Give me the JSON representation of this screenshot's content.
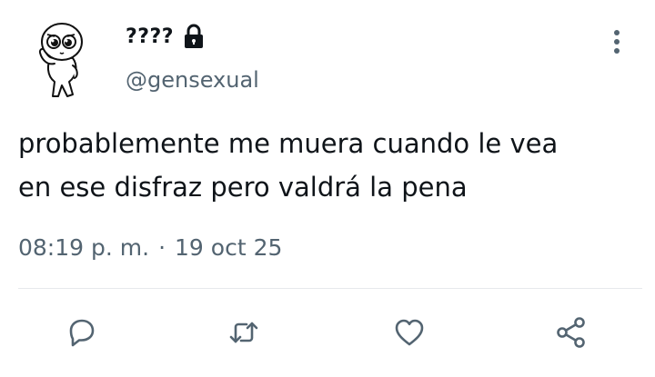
{
  "tweet": {
    "display_name": "????",
    "handle": "@gensexual",
    "text": "probablemente me muera cuando le vea\nen ese disfraz pero valdrá la pena",
    "time": "08:19 p. m.",
    "separator": "·",
    "date": "19 oct 25",
    "protected": true
  },
  "icons": {
    "lock": "lock-icon",
    "more": "more-vertical-icon",
    "reply": "reply-icon",
    "retweet": "retweet-icon",
    "like": "heart-icon",
    "share": "share-icon"
  },
  "colors": {
    "text_primary": "#0f1419",
    "text_secondary": "#536471",
    "divider": "#e6e9ec",
    "background": "#ffffff"
  }
}
